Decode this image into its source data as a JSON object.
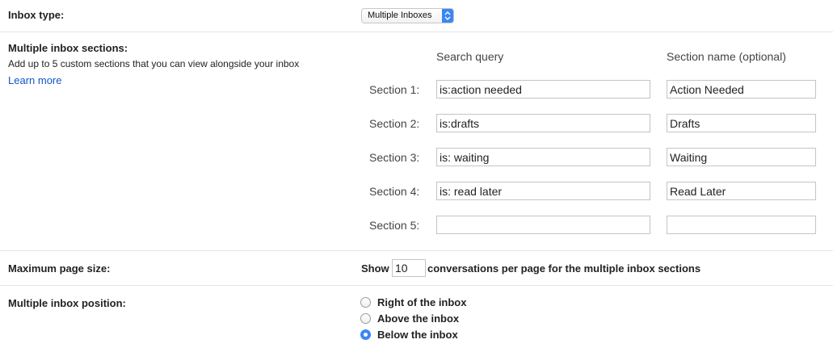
{
  "inbox_type": {
    "label": "Inbox type:",
    "selected": "Multiple Inboxes"
  },
  "sections": {
    "label": "Multiple inbox sections:",
    "description": "Add up to 5 custom sections that you can view alongside your inbox",
    "learn_more": "Learn more",
    "query_header": "Search query",
    "name_header": "Section name (optional)",
    "items": [
      {
        "label": "Section 1:",
        "query": "is:action needed",
        "name": "Action Needed"
      },
      {
        "label": "Section 2:",
        "query": "is:drafts",
        "name": "Drafts"
      },
      {
        "label": "Section 3:",
        "query": "is: waiting",
        "name": "Waiting"
      },
      {
        "label": "Section 4:",
        "query": "is: read later",
        "name": "Read Later"
      },
      {
        "label": "Section 5:",
        "query": "",
        "name": ""
      }
    ]
  },
  "page_size": {
    "label": "Maximum page size:",
    "show_text": "Show",
    "value": "10",
    "suffix": "conversations per page for the multiple inbox sections"
  },
  "position": {
    "label": "Multiple inbox position:",
    "options": [
      {
        "label": "Right of the inbox",
        "checked": false
      },
      {
        "label": "Above the inbox",
        "checked": false
      },
      {
        "label": "Below the inbox",
        "checked": true
      }
    ]
  },
  "colors": {
    "accent": "#3b86f7",
    "link": "#1155cc",
    "divider": "#e5e5e5"
  }
}
